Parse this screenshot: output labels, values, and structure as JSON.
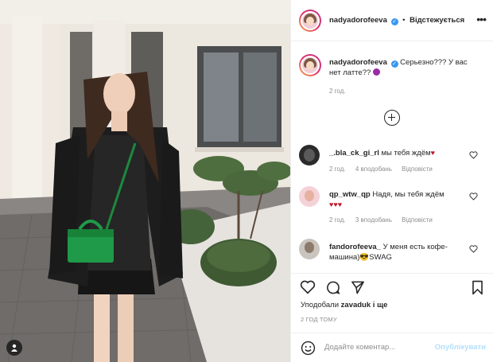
{
  "post": {
    "author": "nadyadorofeeva",
    "follow_status": "Відстежується",
    "more_icon": "more-horizontal-icon"
  },
  "caption": {
    "author": "nadyadorofeeva",
    "text": "Серьезно??? У вас нет латте??",
    "emoji": "devil-emoji",
    "time": "2 год."
  },
  "comments": [
    {
      "author": "_.bla_ck_gi_rl",
      "text": "мы тебя ждём",
      "time": "2 год.",
      "likes": "4 вподобань",
      "reply": "Відповісти"
    },
    {
      "author": "qp_wtw_qp",
      "text": "Надя, мы тебя ждём",
      "time": "2 год.",
      "likes": "3 вподобань",
      "reply": "Відповісти"
    },
    {
      "author": "fandorofeeva_",
      "text": "У меня есть кофе-машина)😎SWAG"
    }
  ],
  "actions": {
    "liked_by_prefix": "Уподобали ",
    "liked_by_user": "zavaduk",
    "liked_by_suffix": " і ще",
    "time_ago": "2 ГОД ТОМУ"
  },
  "add_comment": {
    "placeholder": "Додайте коментар...",
    "publish_label": "Опублікувати"
  },
  "colors": {
    "verified": "#3897f0",
    "publish_disabled": "#b2dffc",
    "heart": "#c0172b"
  }
}
